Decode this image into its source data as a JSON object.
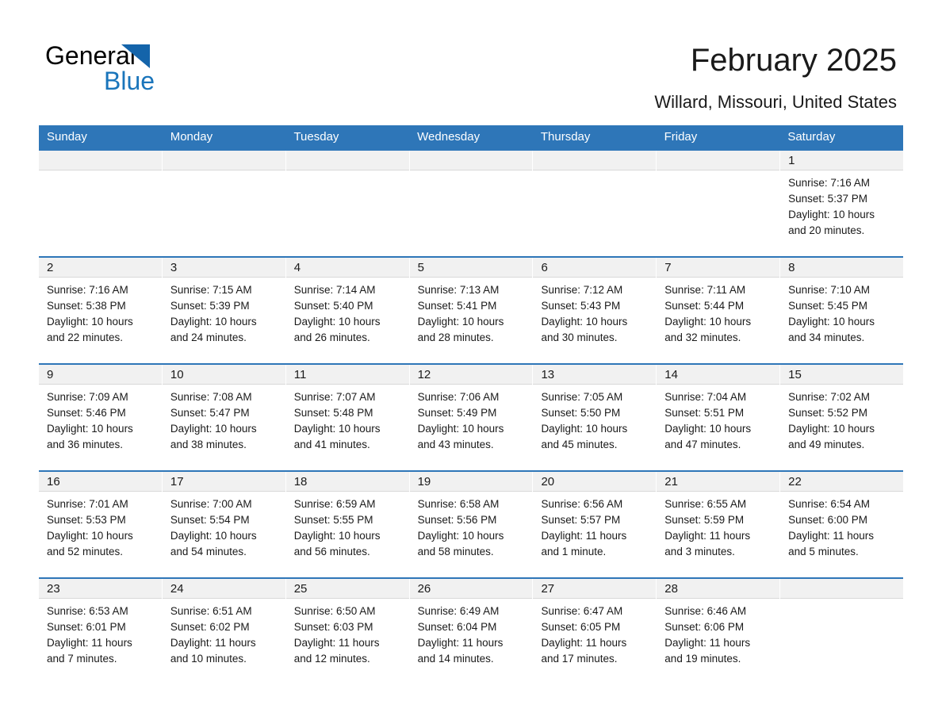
{
  "brand": {
    "name_part1": "General",
    "name_part2": "Blue",
    "triangle_color": "#1464aa",
    "blue_color": "#1a75bb"
  },
  "header": {
    "title": "February 2025",
    "location": "Willard, Missouri, United States"
  },
  "theme": {
    "header_blue": "#2e76b8",
    "day_band_gray": "#f1f1f1",
    "text_color": "#1a1a1a"
  },
  "weekday_headers": [
    "Sunday",
    "Monday",
    "Tuesday",
    "Wednesday",
    "Thursday",
    "Friday",
    "Saturday"
  ],
  "labels": {
    "sunrise_prefix": "Sunrise: ",
    "sunset_prefix": "Sunset: ",
    "daylight_prefix": "Daylight: "
  },
  "weeks": [
    {
      "days": [
        {
          "num": "",
          "sunrise": "",
          "sunset": "",
          "daylight_line1": "",
          "daylight_line2": "",
          "empty": true
        },
        {
          "num": "",
          "sunrise": "",
          "sunset": "",
          "daylight_line1": "",
          "daylight_line2": "",
          "empty": true
        },
        {
          "num": "",
          "sunrise": "",
          "sunset": "",
          "daylight_line1": "",
          "daylight_line2": "",
          "empty": true
        },
        {
          "num": "",
          "sunrise": "",
          "sunset": "",
          "daylight_line1": "",
          "daylight_line2": "",
          "empty": true
        },
        {
          "num": "",
          "sunrise": "",
          "sunset": "",
          "daylight_line1": "",
          "daylight_line2": "",
          "empty": true
        },
        {
          "num": "",
          "sunrise": "",
          "sunset": "",
          "daylight_line1": "",
          "daylight_line2": "",
          "empty": true
        },
        {
          "num": "1",
          "sunrise": "Sunrise: 7:16 AM",
          "sunset": "Sunset: 5:37 PM",
          "daylight_line1": "Daylight: 10 hours",
          "daylight_line2": "and 20 minutes.",
          "empty": false
        }
      ]
    },
    {
      "days": [
        {
          "num": "2",
          "sunrise": "Sunrise: 7:16 AM",
          "sunset": "Sunset: 5:38 PM",
          "daylight_line1": "Daylight: 10 hours",
          "daylight_line2": "and 22 minutes.",
          "empty": false
        },
        {
          "num": "3",
          "sunrise": "Sunrise: 7:15 AM",
          "sunset": "Sunset: 5:39 PM",
          "daylight_line1": "Daylight: 10 hours",
          "daylight_line2": "and 24 minutes.",
          "empty": false
        },
        {
          "num": "4",
          "sunrise": "Sunrise: 7:14 AM",
          "sunset": "Sunset: 5:40 PM",
          "daylight_line1": "Daylight: 10 hours",
          "daylight_line2": "and 26 minutes.",
          "empty": false
        },
        {
          "num": "5",
          "sunrise": "Sunrise: 7:13 AM",
          "sunset": "Sunset: 5:41 PM",
          "daylight_line1": "Daylight: 10 hours",
          "daylight_line2": "and 28 minutes.",
          "empty": false
        },
        {
          "num": "6",
          "sunrise": "Sunrise: 7:12 AM",
          "sunset": "Sunset: 5:43 PM",
          "daylight_line1": "Daylight: 10 hours",
          "daylight_line2": "and 30 minutes.",
          "empty": false
        },
        {
          "num": "7",
          "sunrise": "Sunrise: 7:11 AM",
          "sunset": "Sunset: 5:44 PM",
          "daylight_line1": "Daylight: 10 hours",
          "daylight_line2": "and 32 minutes.",
          "empty": false
        },
        {
          "num": "8",
          "sunrise": "Sunrise: 7:10 AM",
          "sunset": "Sunset: 5:45 PM",
          "daylight_line1": "Daylight: 10 hours",
          "daylight_line2": "and 34 minutes.",
          "empty": false
        }
      ]
    },
    {
      "days": [
        {
          "num": "9",
          "sunrise": "Sunrise: 7:09 AM",
          "sunset": "Sunset: 5:46 PM",
          "daylight_line1": "Daylight: 10 hours",
          "daylight_line2": "and 36 minutes.",
          "empty": false
        },
        {
          "num": "10",
          "sunrise": "Sunrise: 7:08 AM",
          "sunset": "Sunset: 5:47 PM",
          "daylight_line1": "Daylight: 10 hours",
          "daylight_line2": "and 38 minutes.",
          "empty": false
        },
        {
          "num": "11",
          "sunrise": "Sunrise: 7:07 AM",
          "sunset": "Sunset: 5:48 PM",
          "daylight_line1": "Daylight: 10 hours",
          "daylight_line2": "and 41 minutes.",
          "empty": false
        },
        {
          "num": "12",
          "sunrise": "Sunrise: 7:06 AM",
          "sunset": "Sunset: 5:49 PM",
          "daylight_line1": "Daylight: 10 hours",
          "daylight_line2": "and 43 minutes.",
          "empty": false
        },
        {
          "num": "13",
          "sunrise": "Sunrise: 7:05 AM",
          "sunset": "Sunset: 5:50 PM",
          "daylight_line1": "Daylight: 10 hours",
          "daylight_line2": "and 45 minutes.",
          "empty": false
        },
        {
          "num": "14",
          "sunrise": "Sunrise: 7:04 AM",
          "sunset": "Sunset: 5:51 PM",
          "daylight_line1": "Daylight: 10 hours",
          "daylight_line2": "and 47 minutes.",
          "empty": false
        },
        {
          "num": "15",
          "sunrise": "Sunrise: 7:02 AM",
          "sunset": "Sunset: 5:52 PM",
          "daylight_line1": "Daylight: 10 hours",
          "daylight_line2": "and 49 minutes.",
          "empty": false
        }
      ]
    },
    {
      "days": [
        {
          "num": "16",
          "sunrise": "Sunrise: 7:01 AM",
          "sunset": "Sunset: 5:53 PM",
          "daylight_line1": "Daylight: 10 hours",
          "daylight_line2": "and 52 minutes.",
          "empty": false
        },
        {
          "num": "17",
          "sunrise": "Sunrise: 7:00 AM",
          "sunset": "Sunset: 5:54 PM",
          "daylight_line1": "Daylight: 10 hours",
          "daylight_line2": "and 54 minutes.",
          "empty": false
        },
        {
          "num": "18",
          "sunrise": "Sunrise: 6:59 AM",
          "sunset": "Sunset: 5:55 PM",
          "daylight_line1": "Daylight: 10 hours",
          "daylight_line2": "and 56 minutes.",
          "empty": false
        },
        {
          "num": "19",
          "sunrise": "Sunrise: 6:58 AM",
          "sunset": "Sunset: 5:56 PM",
          "daylight_line1": "Daylight: 10 hours",
          "daylight_line2": "and 58 minutes.",
          "empty": false
        },
        {
          "num": "20",
          "sunrise": "Sunrise: 6:56 AM",
          "sunset": "Sunset: 5:57 PM",
          "daylight_line1": "Daylight: 11 hours",
          "daylight_line2": "and 1 minute.",
          "empty": false
        },
        {
          "num": "21",
          "sunrise": "Sunrise: 6:55 AM",
          "sunset": "Sunset: 5:59 PM",
          "daylight_line1": "Daylight: 11 hours",
          "daylight_line2": "and 3 minutes.",
          "empty": false
        },
        {
          "num": "22",
          "sunrise": "Sunrise: 6:54 AM",
          "sunset": "Sunset: 6:00 PM",
          "daylight_line1": "Daylight: 11 hours",
          "daylight_line2": "and 5 minutes.",
          "empty": false
        }
      ]
    },
    {
      "days": [
        {
          "num": "23",
          "sunrise": "Sunrise: 6:53 AM",
          "sunset": "Sunset: 6:01 PM",
          "daylight_line1": "Daylight: 11 hours",
          "daylight_line2": "and 7 minutes.",
          "empty": false
        },
        {
          "num": "24",
          "sunrise": "Sunrise: 6:51 AM",
          "sunset": "Sunset: 6:02 PM",
          "daylight_line1": "Daylight: 11 hours",
          "daylight_line2": "and 10 minutes.",
          "empty": false
        },
        {
          "num": "25",
          "sunrise": "Sunrise: 6:50 AM",
          "sunset": "Sunset: 6:03 PM",
          "daylight_line1": "Daylight: 11 hours",
          "daylight_line2": "and 12 minutes.",
          "empty": false
        },
        {
          "num": "26",
          "sunrise": "Sunrise: 6:49 AM",
          "sunset": "Sunset: 6:04 PM",
          "daylight_line1": "Daylight: 11 hours",
          "daylight_line2": "and 14 minutes.",
          "empty": false
        },
        {
          "num": "27",
          "sunrise": "Sunrise: 6:47 AM",
          "sunset": "Sunset: 6:05 PM",
          "daylight_line1": "Daylight: 11 hours",
          "daylight_line2": "and 17 minutes.",
          "empty": false
        },
        {
          "num": "28",
          "sunrise": "Sunrise: 6:46 AM",
          "sunset": "Sunset: 6:06 PM",
          "daylight_line1": "Daylight: 11 hours",
          "daylight_line2": "and 19 minutes.",
          "empty": false
        },
        {
          "num": "",
          "sunrise": "",
          "sunset": "",
          "daylight_line1": "",
          "daylight_line2": "",
          "empty": true
        }
      ]
    }
  ]
}
